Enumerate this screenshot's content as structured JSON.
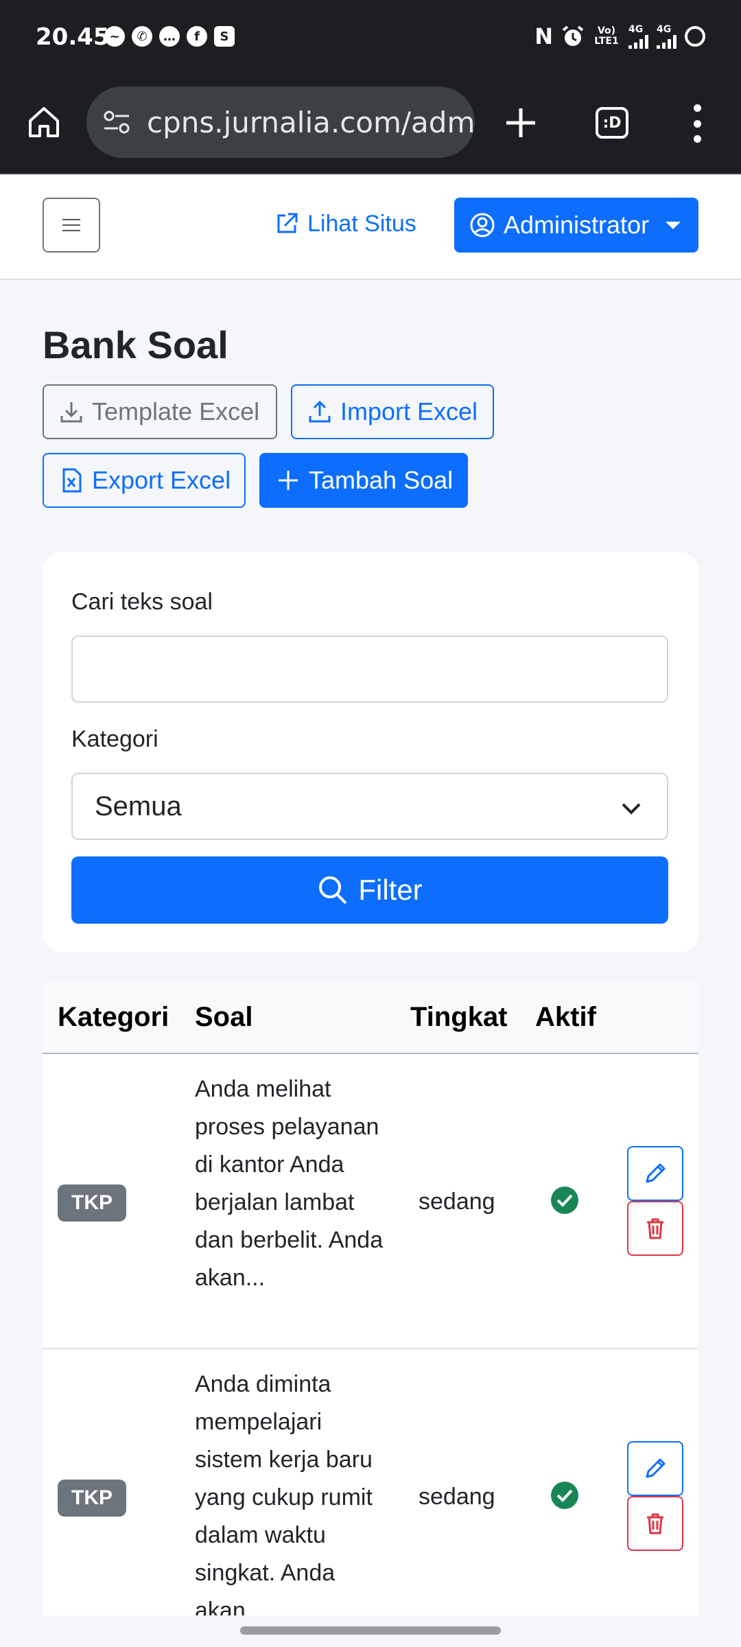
{
  "status_bar": {
    "time": "20.45",
    "volte_label": "Vo) LTE1",
    "net_1": "4G",
    "net_2": "4G"
  },
  "browser": {
    "url": "cpns.jurnalia.com/admin",
    "tab_switcher_label": ":D"
  },
  "navbar": {
    "view_site_label": "Lihat Situs",
    "user_label": "Administrator"
  },
  "page": {
    "title": "Bank Soal",
    "buttons": {
      "template_excel": "Template Excel",
      "import_excel": "Import Excel",
      "export_excel": "Export Excel",
      "add_question": "Tambah Soal"
    }
  },
  "filter": {
    "search_label": "Cari teks soal",
    "search_value": "",
    "category_label": "Kategori",
    "category_selected": "Semua",
    "filter_button": "Filter"
  },
  "table": {
    "columns": [
      "Kategori",
      "Soal",
      "Tingkat",
      "Aktif"
    ],
    "rows": [
      {
        "kategori": "TKP",
        "soal": "Anda melihat proses pelayanan di kantor Anda berjalan lambat dan berbelit. Anda akan...",
        "tingkat": "sedang",
        "aktif": true
      },
      {
        "kategori": "TKP",
        "soal": "Anda diminta mempelajari sistem kerja baru yang cukup rumit dalam waktu singkat. Anda akan...",
        "tingkat": "sedang",
        "aktif": true
      }
    ]
  },
  "colors": {
    "primary": "#0d6efd",
    "secondary": "#6c757d",
    "danger": "#dc3545",
    "success": "#198754",
    "page_bg": "#f4f6f9",
    "chrome_bg": "#1c1e22"
  }
}
